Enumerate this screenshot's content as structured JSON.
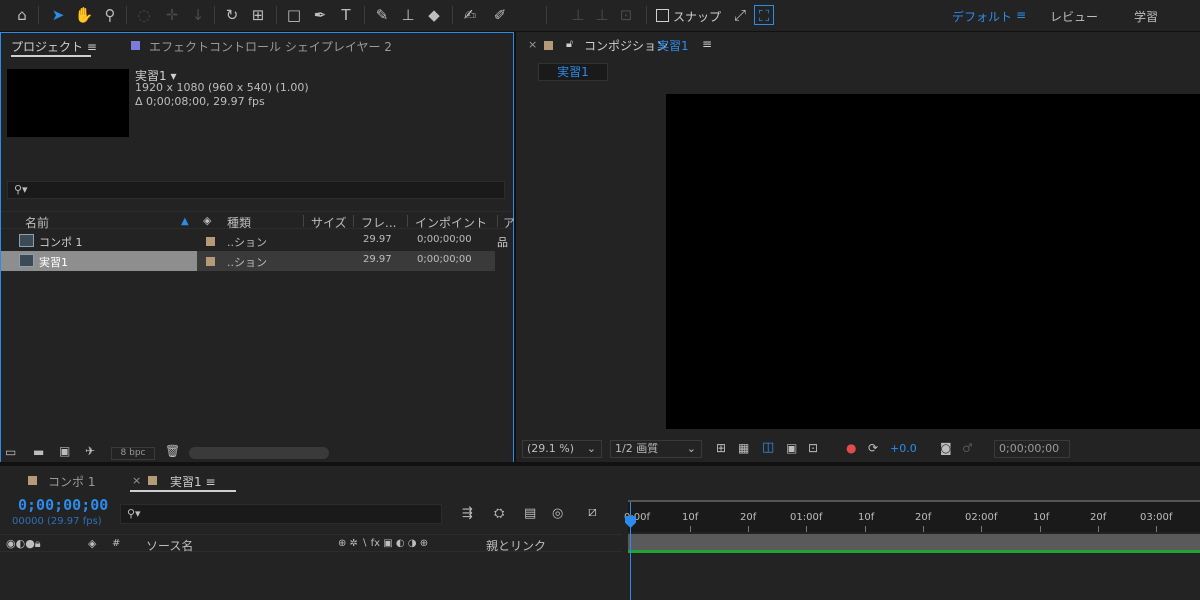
{
  "toolbar": {
    "snap_label": "スナップ",
    "workspaces": [
      "デフォルト",
      "≡",
      "レビュー",
      "学習"
    ]
  },
  "project_panel": {
    "tab_label": "プロジェクト  ≡",
    "effect_tab_label": "エフェクトコントロール シェイプレイヤー 2",
    "selected_name": "実習1 ▾",
    "selected_resolution": "1920 x 1080  (960 x 540) (1.00)",
    "selected_duration": "Δ 0;00;08;00, 29.97 fps",
    "search_placeholder": "",
    "columns": [
      "名前",
      "種類",
      "サイズ",
      "フレ...",
      "インポイント",
      "ア"
    ],
    "items": [
      {
        "name": "コンポ 1",
        "type": "..ション",
        "fps": "29.97",
        "in": "0;00;00;00"
      },
      {
        "name": "実習1",
        "type": "..ション",
        "fps": "29.97",
        "in": "0;00;00;00"
      }
    ],
    "bpc": "8 bpc"
  },
  "comp_panel": {
    "tab_prefix": "コンポジション",
    "tab_name": "実習1",
    "tab_menu": "≡",
    "viewer_tab": "実習1",
    "zoom": "(29.1 %)",
    "resolution": "1/2 画質",
    "exposure": "+0.0",
    "timecode": "0;00;00;00"
  },
  "timeline": {
    "tabs": [
      {
        "label": "コンポ 1"
      },
      {
        "label": "実習1  ≡"
      }
    ],
    "timecode": "0;00;00;00",
    "frames_fps": "00000 (29.97 fps)",
    "ruler_labels": [
      "0:00f",
      "10f",
      "20f",
      "01:00f",
      "10f",
      "20f",
      "02:00f",
      "10f",
      "20f",
      "03:00f"
    ],
    "layer_columns": {
      "hash": "#",
      "source": "ソース名",
      "switches": "⊕ ✲ ∖ fx ▣ ◐ ◑ ⊕",
      "parent": "親とリンク"
    }
  },
  "colors": {
    "accent": "#2d8ceb",
    "panel": "#232323",
    "label_tan": "#b49a76",
    "effect_chip": "#7b7bdc",
    "track_green": "#1fa533"
  }
}
